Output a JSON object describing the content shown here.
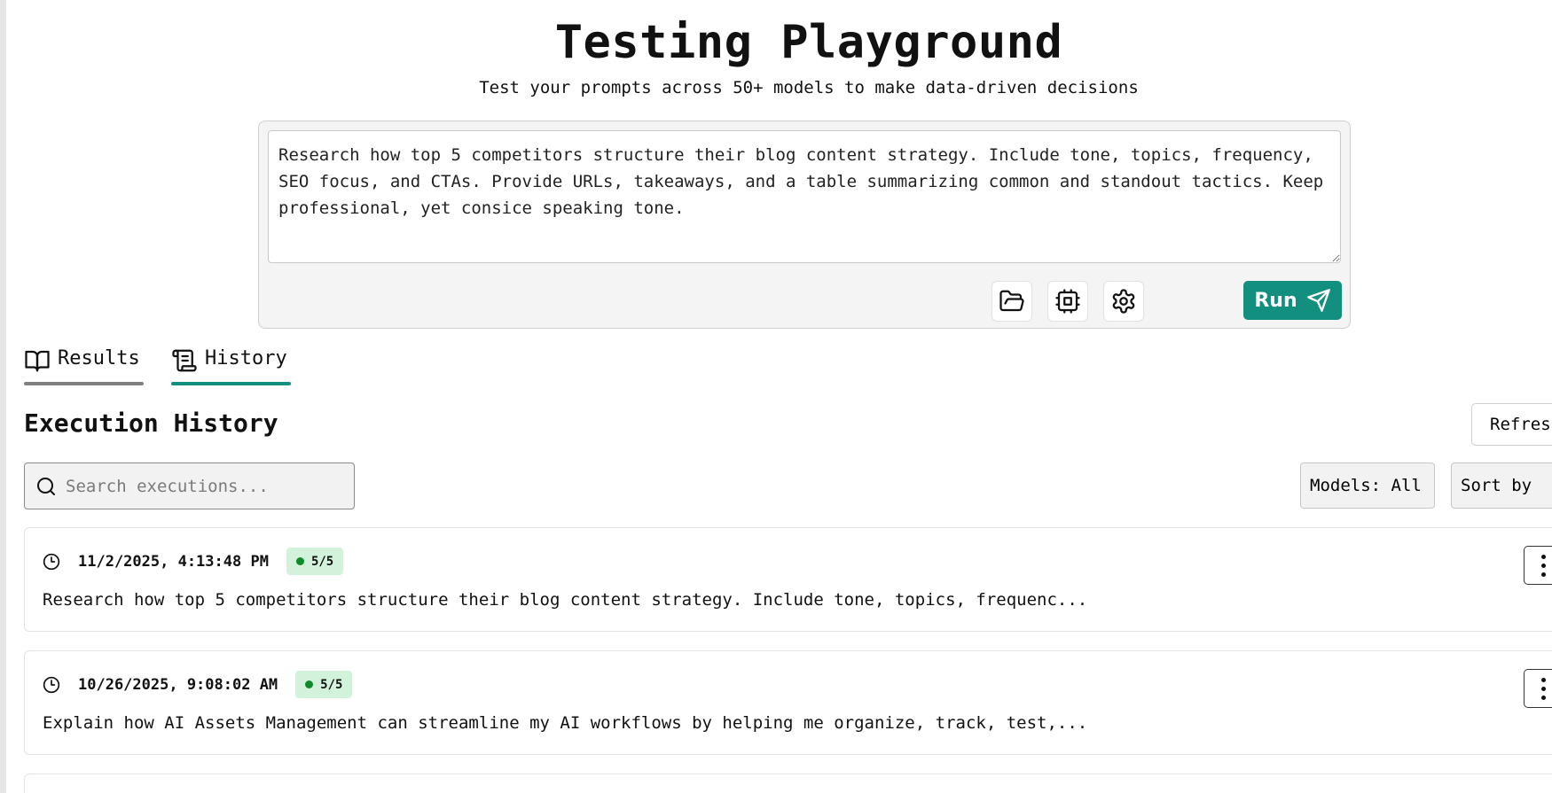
{
  "header": {
    "title": "Testing Playground",
    "subtitle": "Test your prompts across 50+ models to make data-driven decisions"
  },
  "prompt": {
    "value": "Research how top 5 competitors structure their blog content strategy. Include tone, topics, frequency, SEO focus, and CTAs. Provide URLs, takeaways, and a table summarizing common and standout tactics. Keep professional, yet consice speaking tone.",
    "run_label": "Run",
    "accent_color": "#138f80"
  },
  "tabs": [
    {
      "label": "Results",
      "icon": "book-open-icon"
    },
    {
      "label": "History",
      "icon": "scroll-icon"
    }
  ],
  "history": {
    "title": "Execution History",
    "refresh_label": "Refres",
    "search_placeholder": "Search executions...",
    "models_filter_label": "Models: All",
    "sort_label": "Sort by",
    "executions": [
      {
        "timestamp": "11/2/2025, 4:13:48 PM",
        "status": "5/5",
        "prompt": "Research how top 5 competitors structure their blog content strategy. Include tone, topics, frequenc..."
      },
      {
        "timestamp": "10/26/2025, 9:08:02 AM",
        "status": "5/5",
        "prompt": "Explain how AI Assets Management can streamline my AI workflows by helping me organize, track, test,..."
      }
    ]
  }
}
